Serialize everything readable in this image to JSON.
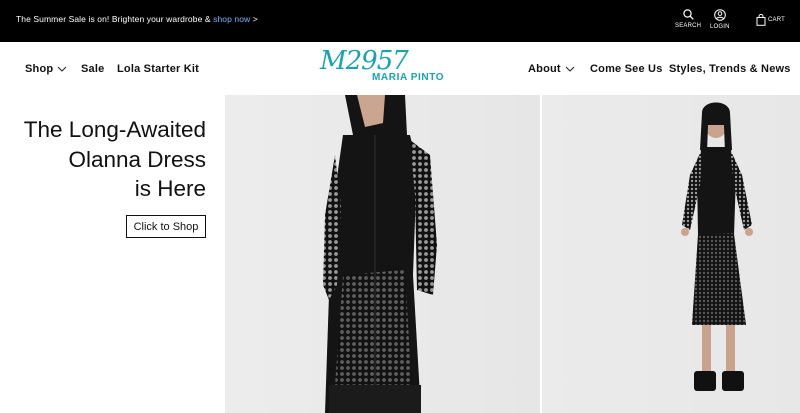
{
  "announcement": {
    "text": "The Summer Sale is on! Brighten your wardrobe & ",
    "link": "shop now",
    "suffix": " >"
  },
  "utility": {
    "search_label": "SEARCH",
    "login_label": "LOGIN",
    "cart_label": "CART"
  },
  "nav": {
    "left": [
      "Shop",
      "Sale",
      "Lola Starter Kit"
    ],
    "right": [
      "About",
      "Come See Us",
      "Styles, Trends & News"
    ]
  },
  "logo": {
    "mark": "M2957",
    "brand": "MARIA PINTO"
  },
  "hero": {
    "headline_lines": [
      "The Long-Awaited",
      "Olanna Dress",
      "is Here"
    ],
    "cta": "Click to Shop"
  },
  "colors": {
    "topbar": "#000000",
    "link": "#6fb7ff",
    "brand_teal": "#1aa3ad"
  },
  "icons": [
    "search-icon",
    "user-icon",
    "bag-icon",
    "chevron-down-icon"
  ]
}
